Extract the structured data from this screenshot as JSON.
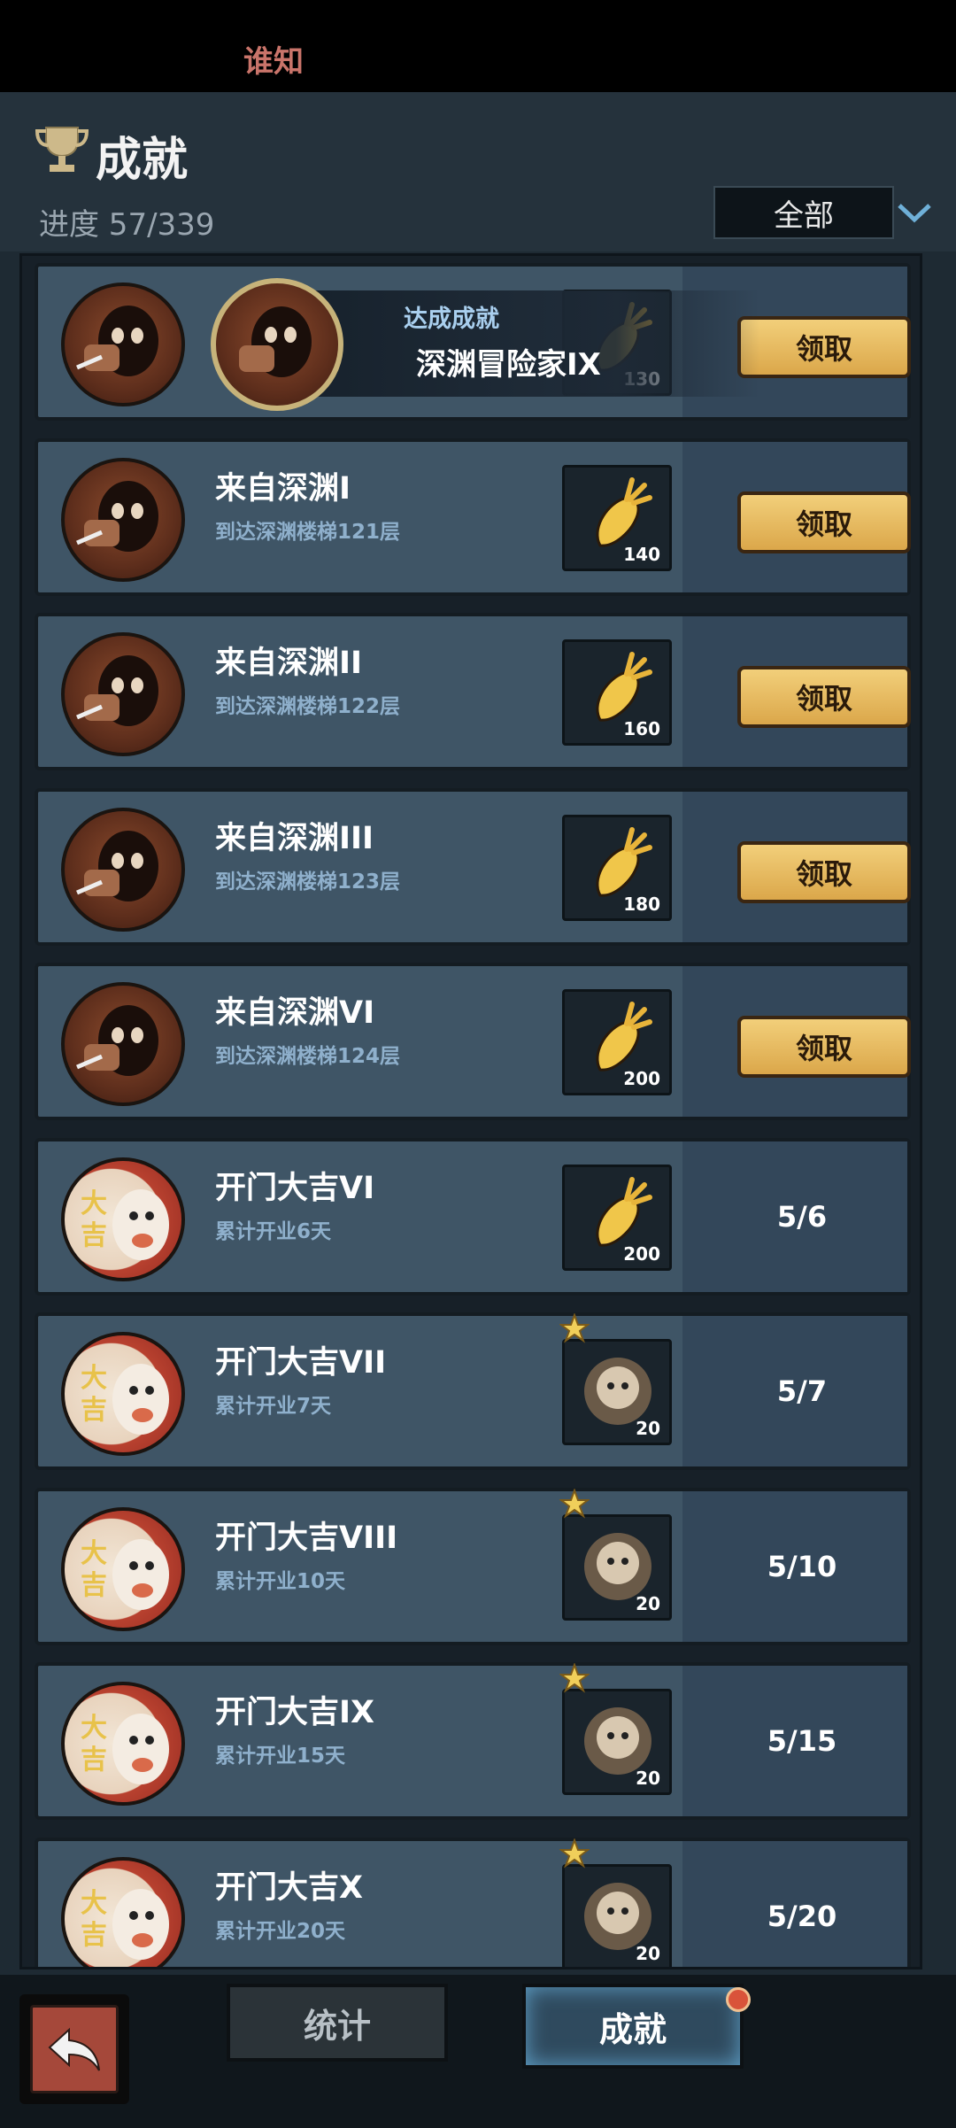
{
  "status_bar": {
    "app_name": "谁知"
  },
  "header": {
    "title": "成就",
    "progress_text": "进度 57/339",
    "filter_value": "全部"
  },
  "toast": {
    "label": "达成成就",
    "name": "深渊冒险家IX"
  },
  "achievements": [
    {
      "name": "",
      "desc": "",
      "reward_count": "130",
      "claim": "领取"
    },
    {
      "name": "来自深渊I",
      "desc": "到达深渊楼梯121层",
      "reward_count": "140",
      "claim": "领取"
    },
    {
      "name": "来自深渊II",
      "desc": "到达深渊楼梯122层",
      "reward_count": "160",
      "claim": "领取"
    },
    {
      "name": "来自深渊III",
      "desc": "到达深渊楼梯123层",
      "reward_count": "180",
      "claim": "领取"
    },
    {
      "name": "来自深渊VI",
      "desc": "到达深渊楼梯124层",
      "reward_count": "200",
      "claim": "领取"
    },
    {
      "name": "开门大吉VI",
      "desc": "累计开业6天",
      "reward_count": "200",
      "progress": "5/6"
    },
    {
      "name": "开门大吉VII",
      "desc": "累计开业7天",
      "reward_count": "20",
      "progress": "5/7"
    },
    {
      "name": "开门大吉VIII",
      "desc": "累计开业10天",
      "reward_count": "20",
      "progress": "5/10"
    },
    {
      "name": "开门大吉IX",
      "desc": "累计开业15天",
      "reward_count": "20",
      "progress": "5/15"
    },
    {
      "name": "开门大吉X",
      "desc": "累计开业20天",
      "reward_count": "20",
      "progress": "5/20"
    }
  ],
  "tabs": {
    "stats": "统计",
    "achievements": "成就"
  },
  "colors": {
    "claim_button": "#dba74a",
    "card": "#3f5566",
    "accent_blue": "#a9cfee"
  },
  "icons": [
    "trophy-icon",
    "chevron-down-icon",
    "carrot-icon",
    "star-icon",
    "back-arrow-icon"
  ]
}
